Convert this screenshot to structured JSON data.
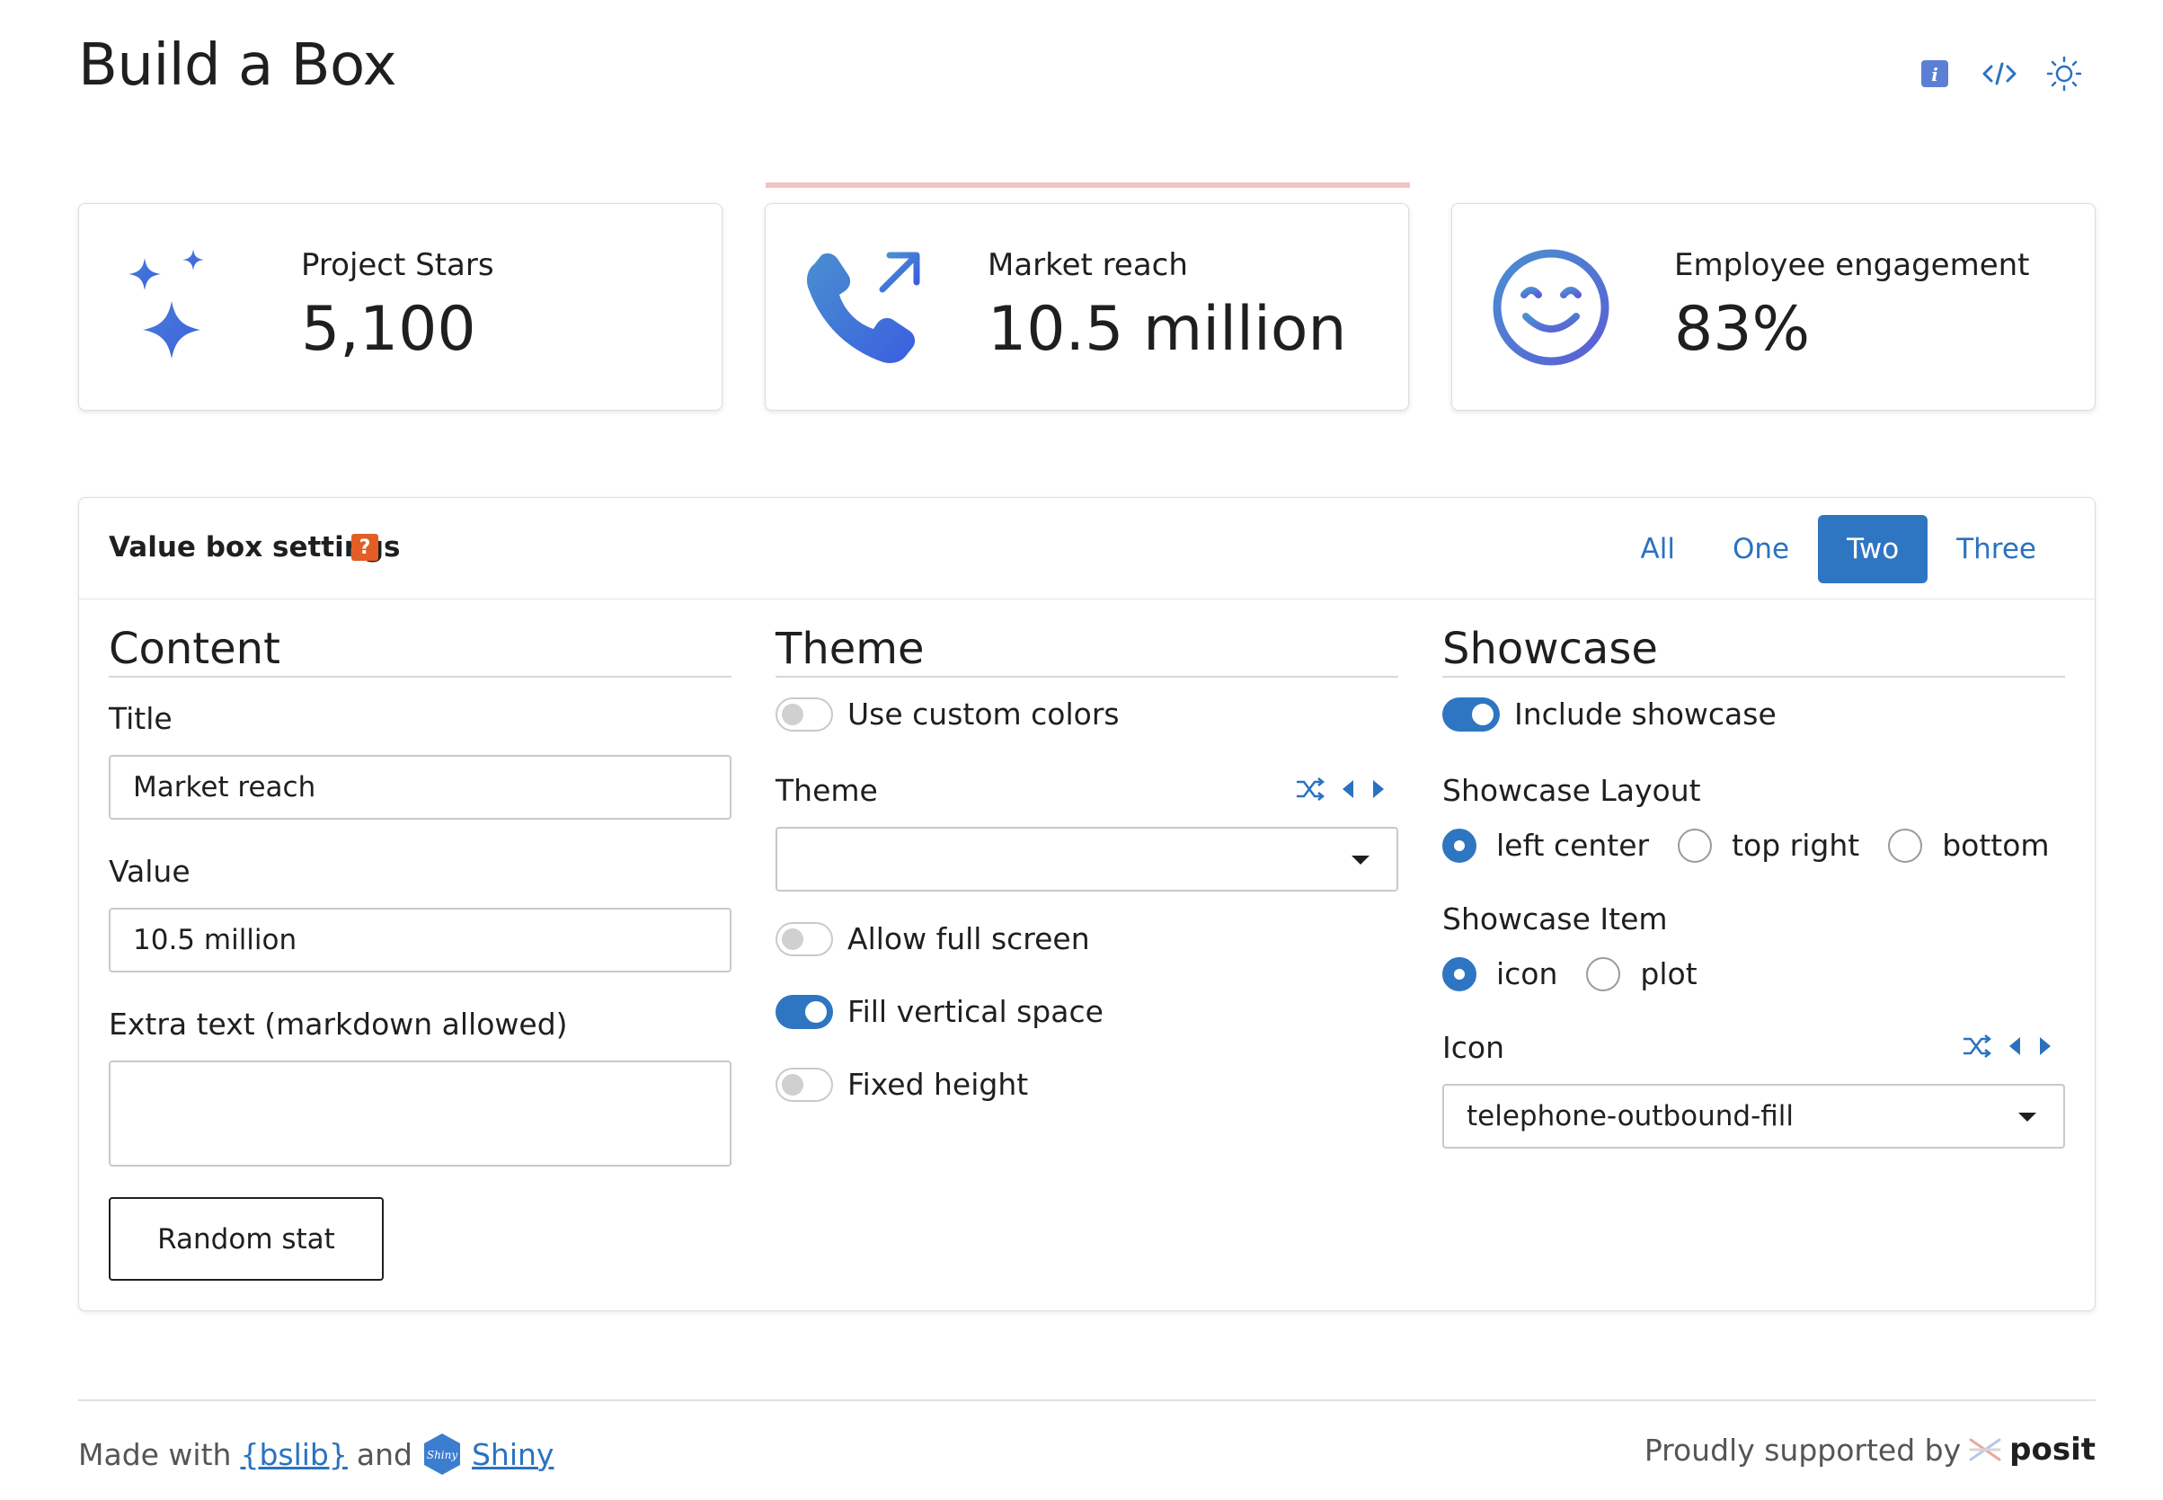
{
  "page": {
    "title": "Build a Box"
  },
  "header_icons": [
    "info-icon",
    "code-icon",
    "sun-icon"
  ],
  "value_boxes": [
    {
      "title": "Project Stars",
      "value": "5,100",
      "icon": "stars-icon"
    },
    {
      "title": "Market reach",
      "value": "10.5 million",
      "icon": "telephone-outbound-fill-icon"
    },
    {
      "title": "Employee engagement",
      "value": "83%",
      "icon": "emoji-smile-icon"
    }
  ],
  "settings": {
    "title": "Value box settings",
    "help": "?",
    "tabs": [
      {
        "label": "All",
        "active": false
      },
      {
        "label": "One",
        "active": false
      },
      {
        "label": "Two",
        "active": true
      },
      {
        "label": "Three",
        "active": false
      }
    ]
  },
  "content": {
    "heading": "Content",
    "title_label": "Title",
    "title_value": "Market reach",
    "value_label": "Value",
    "value_value": "10.5 million",
    "extra_label": "Extra text (markdown allowed)",
    "extra_value": "",
    "random_button": "Random stat"
  },
  "theme": {
    "heading": "Theme",
    "custom_colors_label": "Use custom colors",
    "custom_colors_on": false,
    "theme_label": "Theme",
    "theme_value": "",
    "full_screen_label": "Allow full screen",
    "full_screen_on": false,
    "fill_label": "Fill vertical space",
    "fill_on": true,
    "fixed_height_label": "Fixed height",
    "fixed_height_on": false
  },
  "showcase": {
    "heading": "Showcase",
    "include_label": "Include showcase",
    "include_on": true,
    "layout_label": "Showcase Layout",
    "layout_options": [
      "left center",
      "top right",
      "bottom"
    ],
    "layout_selected": "left center",
    "item_label": "Showcase Item",
    "item_options": [
      "icon",
      "plot"
    ],
    "item_selected": "icon",
    "icon_label": "Icon",
    "icon_value": "telephone-outbound-fill"
  },
  "footer": {
    "made_with": "Made with",
    "bslib": "{bslib}",
    "and": "and",
    "shiny": "Shiny",
    "supported": "Proudly supported by",
    "posit": "posit"
  },
  "colors": {
    "accent": "#2f76c2",
    "badge": "#e35d26",
    "progress": "#f0c4c0"
  }
}
